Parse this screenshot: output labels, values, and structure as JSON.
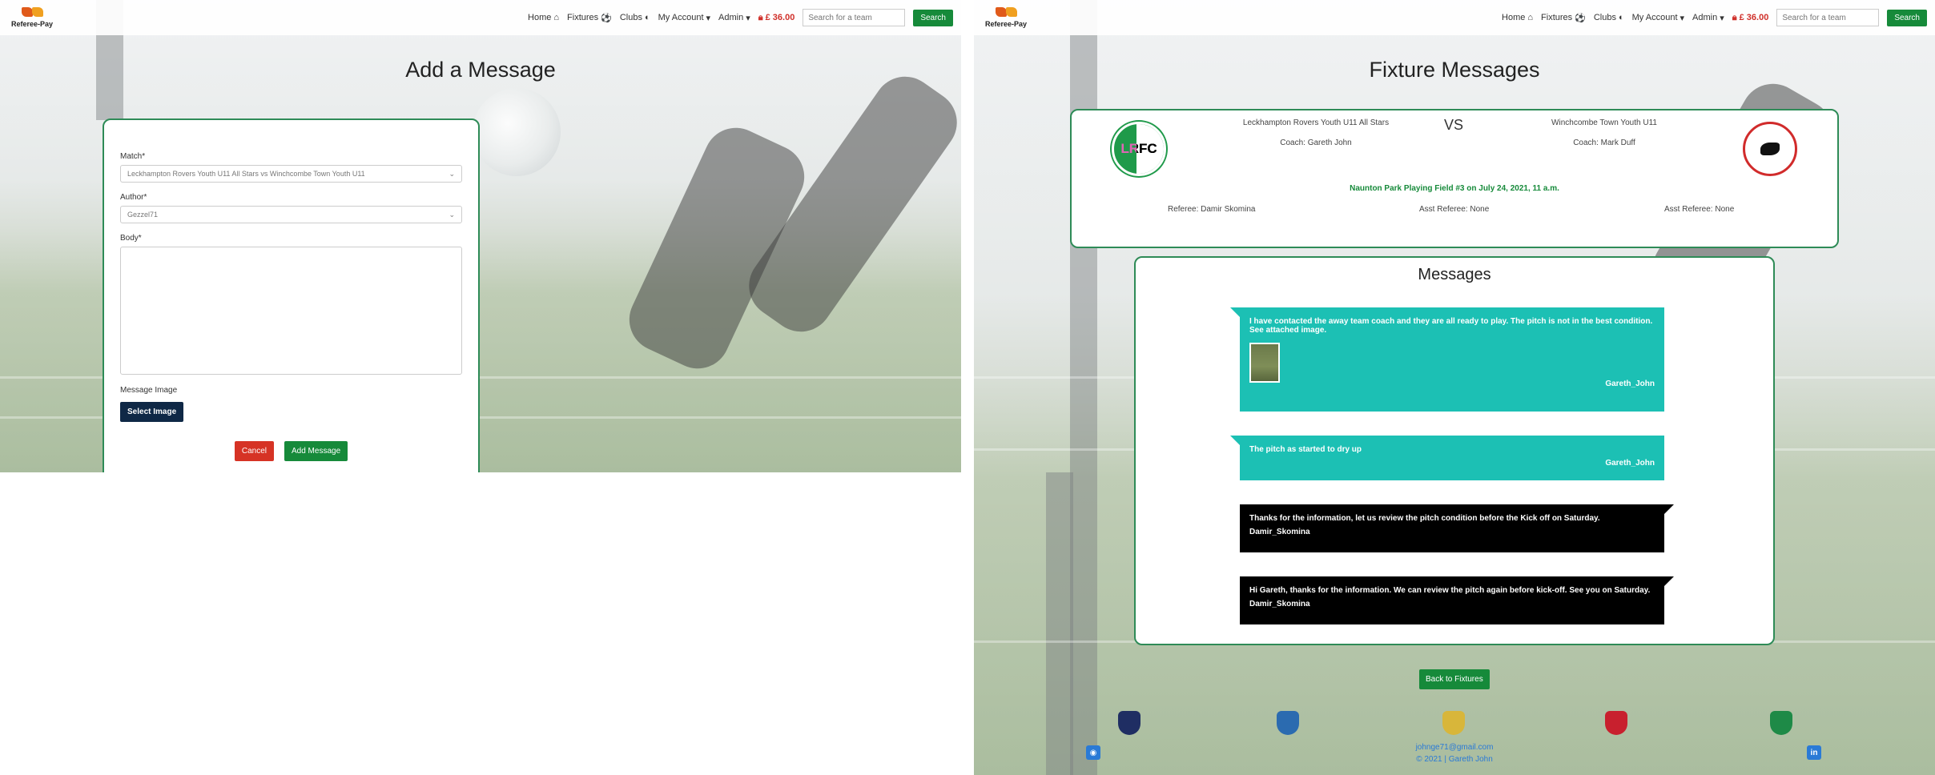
{
  "nav": {
    "brand": "Referee-Pay",
    "home": "Home",
    "fixtures": "Fixtures",
    "clubs": "Clubs",
    "my_account": "My Account",
    "admin": "Admin",
    "cart": "£ 36.00",
    "search_placeholder": "Search for a team",
    "search_button": "Search"
  },
  "add_message": {
    "title": "Add a Message",
    "match_label": "Match*",
    "match_value": "Leckhampton Rovers Youth U11 All Stars vs Winchcombe Town Youth U11",
    "author_label": "Author*",
    "author_value": "Gezzel71",
    "body_label": "Body*",
    "image_label": "Message Image",
    "select_image": "Select Image",
    "cancel": "Cancel",
    "submit": "Add Message"
  },
  "fixture": {
    "title": "Fixture Messages",
    "home_team": "Leckhampton Rovers Youth U11 All Stars",
    "home_coach": "Coach: Gareth John",
    "home_crest_text": "LRFC",
    "vs": "VS",
    "away_team": "Winchcombe Town Youth U11",
    "away_coach": "Coach: Mark Duff",
    "venue": "Naunton Park Playing Field #3 on July 24, 2021, 11 a.m.",
    "referee": "Referee: Damir Skomina",
    "asst_1": "Asst Referee: None",
    "asst_2": "Asst Referee: None"
  },
  "messages": {
    "title": "Messages",
    "items": [
      {
        "text": "I have contacted the away team coach and they are all ready to play. The pitch is not in the best condition. See attached image.",
        "author": "Gareth_John"
      },
      {
        "text": "The pitch as started to dry up",
        "author": "Gareth_John"
      },
      {
        "text": "Thanks for the information, let us review the pitch condition before the Kick off on Saturday.",
        "author": "Damir_Skomina"
      },
      {
        "text": "Hi Gareth, thanks for the information. We can review the pitch again before kick-off. See you on Saturday.",
        "author": "Damir_Skomina"
      }
    ],
    "back_button": "Back to Fixtures"
  },
  "footer": {
    "email": "johnge71@gmail.com",
    "copyright": "© 2021 | Gareth John"
  },
  "colors": {
    "brand_green": "#168a3a",
    "teal_bubble": "#1cc0b4",
    "cancel_red": "#d63325",
    "navy": "#0f2846"
  }
}
